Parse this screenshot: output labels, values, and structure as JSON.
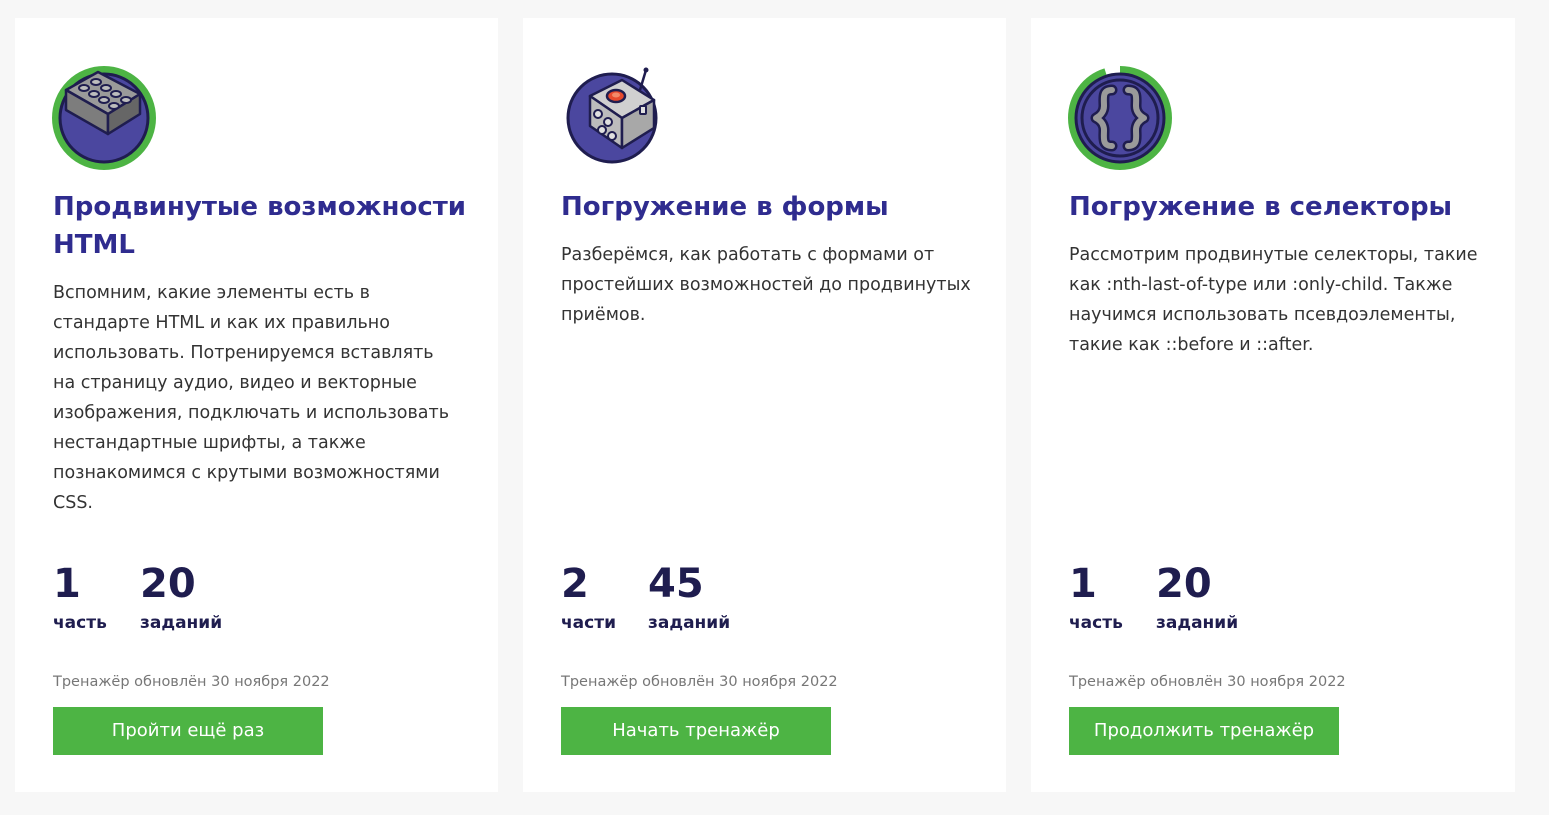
{
  "colors": {
    "title": "#2f2c8f",
    "stat": "#1f1d4f",
    "button": "#4db444",
    "icon_ring": "#4db444",
    "icon_fill": "#4b479f"
  },
  "cards": [
    {
      "icon": "lego-brick-icon",
      "title": "Продвинутые возможности HTML",
      "description": "Вспомним, какие элементы есть в стандарте HTML и как их правильно использовать. Потренируемся вставлять на страницу аудио, видео и векторные изображения, подключать и использовать нестандартные шрифты, а также познакомимся с крутыми возможностями CSS.",
      "stats": [
        {
          "value": "1",
          "label": "часть"
        },
        {
          "value": "20",
          "label": "заданий"
        }
      ],
      "progress": 1.0,
      "updated": "Тренажёр обновлён 30 ноября 2022",
      "button": "Пройти ещё раз"
    },
    {
      "icon": "remote-control-icon",
      "title": "Погружение в формы",
      "description": "Разберёмся, как работать с формами от простейших возможностей до продвинутых приёмов.",
      "stats": [
        {
          "value": "2",
          "label": "части"
        },
        {
          "value": "45",
          "label": "заданий"
        }
      ],
      "progress": 0.0,
      "updated": "Тренажёр обновлён 30 ноября 2022",
      "button": "Начать тренажёр"
    },
    {
      "icon": "curly-braces-icon",
      "title": "Погружение в селекторы",
      "description": "Рассмотрим продвинутые селекторы, такие как :nth-last-of-type или :only-child. Также научимся использовать псевдоэлементы, такие как ::before и ::after.",
      "stats": [
        {
          "value": "1",
          "label": "часть"
        },
        {
          "value": "20",
          "label": "заданий"
        }
      ],
      "progress": 0.95,
      "updated": "Тренажёр обновлён 30 ноября 2022",
      "button": "Продолжить тренажёр"
    }
  ]
}
